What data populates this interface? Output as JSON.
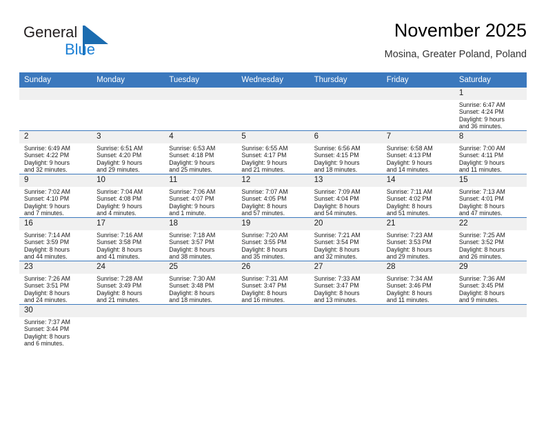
{
  "brand": {
    "name_part1": "General",
    "name_part2": "Blue",
    "logo_icon": "blue-triangle-mark",
    "color_primary": "#1b7fd4",
    "color_header": "#3b78bd"
  },
  "header": {
    "title": "November 2025",
    "subtitle": "Mosina, Greater Poland, Poland"
  },
  "calendar": {
    "weekday_headers": [
      "Sunday",
      "Monday",
      "Tuesday",
      "Wednesday",
      "Thursday",
      "Friday",
      "Saturday"
    ],
    "weeks": [
      [
        {
          "day": "",
          "empty": true
        },
        {
          "day": "",
          "empty": true
        },
        {
          "day": "",
          "empty": true
        },
        {
          "day": "",
          "empty": true
        },
        {
          "day": "",
          "empty": true
        },
        {
          "day": "",
          "empty": true
        },
        {
          "day": "1",
          "sunrise": "Sunrise: 6:47 AM",
          "sunset": "Sunset: 4:24 PM",
          "daylight1": "Daylight: 9 hours",
          "daylight2": "and 36 minutes."
        }
      ],
      [
        {
          "day": "2",
          "sunrise": "Sunrise: 6:49 AM",
          "sunset": "Sunset: 4:22 PM",
          "daylight1": "Daylight: 9 hours",
          "daylight2": "and 32 minutes."
        },
        {
          "day": "3",
          "sunrise": "Sunrise: 6:51 AM",
          "sunset": "Sunset: 4:20 PM",
          "daylight1": "Daylight: 9 hours",
          "daylight2": "and 29 minutes."
        },
        {
          "day": "4",
          "sunrise": "Sunrise: 6:53 AM",
          "sunset": "Sunset: 4:18 PM",
          "daylight1": "Daylight: 9 hours",
          "daylight2": "and 25 minutes."
        },
        {
          "day": "5",
          "sunrise": "Sunrise: 6:55 AM",
          "sunset": "Sunset: 4:17 PM",
          "daylight1": "Daylight: 9 hours",
          "daylight2": "and 21 minutes."
        },
        {
          "day": "6",
          "sunrise": "Sunrise: 6:56 AM",
          "sunset": "Sunset: 4:15 PM",
          "daylight1": "Daylight: 9 hours",
          "daylight2": "and 18 minutes."
        },
        {
          "day": "7",
          "sunrise": "Sunrise: 6:58 AM",
          "sunset": "Sunset: 4:13 PM",
          "daylight1": "Daylight: 9 hours",
          "daylight2": "and 14 minutes."
        },
        {
          "day": "8",
          "sunrise": "Sunrise: 7:00 AM",
          "sunset": "Sunset: 4:11 PM",
          "daylight1": "Daylight: 9 hours",
          "daylight2": "and 11 minutes."
        }
      ],
      [
        {
          "day": "9",
          "sunrise": "Sunrise: 7:02 AM",
          "sunset": "Sunset: 4:10 PM",
          "daylight1": "Daylight: 9 hours",
          "daylight2": "and 7 minutes."
        },
        {
          "day": "10",
          "sunrise": "Sunrise: 7:04 AM",
          "sunset": "Sunset: 4:08 PM",
          "daylight1": "Daylight: 9 hours",
          "daylight2": "and 4 minutes."
        },
        {
          "day": "11",
          "sunrise": "Sunrise: 7:06 AM",
          "sunset": "Sunset: 4:07 PM",
          "daylight1": "Daylight: 9 hours",
          "daylight2": "and 1 minute."
        },
        {
          "day": "12",
          "sunrise": "Sunrise: 7:07 AM",
          "sunset": "Sunset: 4:05 PM",
          "daylight1": "Daylight: 8 hours",
          "daylight2": "and 57 minutes."
        },
        {
          "day": "13",
          "sunrise": "Sunrise: 7:09 AM",
          "sunset": "Sunset: 4:04 PM",
          "daylight1": "Daylight: 8 hours",
          "daylight2": "and 54 minutes."
        },
        {
          "day": "14",
          "sunrise": "Sunrise: 7:11 AM",
          "sunset": "Sunset: 4:02 PM",
          "daylight1": "Daylight: 8 hours",
          "daylight2": "and 51 minutes."
        },
        {
          "day": "15",
          "sunrise": "Sunrise: 7:13 AM",
          "sunset": "Sunset: 4:01 PM",
          "daylight1": "Daylight: 8 hours",
          "daylight2": "and 47 minutes."
        }
      ],
      [
        {
          "day": "16",
          "sunrise": "Sunrise: 7:14 AM",
          "sunset": "Sunset: 3:59 PM",
          "daylight1": "Daylight: 8 hours",
          "daylight2": "and 44 minutes."
        },
        {
          "day": "17",
          "sunrise": "Sunrise: 7:16 AM",
          "sunset": "Sunset: 3:58 PM",
          "daylight1": "Daylight: 8 hours",
          "daylight2": "and 41 minutes."
        },
        {
          "day": "18",
          "sunrise": "Sunrise: 7:18 AM",
          "sunset": "Sunset: 3:57 PM",
          "daylight1": "Daylight: 8 hours",
          "daylight2": "and 38 minutes."
        },
        {
          "day": "19",
          "sunrise": "Sunrise: 7:20 AM",
          "sunset": "Sunset: 3:55 PM",
          "daylight1": "Daylight: 8 hours",
          "daylight2": "and 35 minutes."
        },
        {
          "day": "20",
          "sunrise": "Sunrise: 7:21 AM",
          "sunset": "Sunset: 3:54 PM",
          "daylight1": "Daylight: 8 hours",
          "daylight2": "and 32 minutes."
        },
        {
          "day": "21",
          "sunrise": "Sunrise: 7:23 AM",
          "sunset": "Sunset: 3:53 PM",
          "daylight1": "Daylight: 8 hours",
          "daylight2": "and 29 minutes."
        },
        {
          "day": "22",
          "sunrise": "Sunrise: 7:25 AM",
          "sunset": "Sunset: 3:52 PM",
          "daylight1": "Daylight: 8 hours",
          "daylight2": "and 26 minutes."
        }
      ],
      [
        {
          "day": "23",
          "sunrise": "Sunrise: 7:26 AM",
          "sunset": "Sunset: 3:51 PM",
          "daylight1": "Daylight: 8 hours",
          "daylight2": "and 24 minutes."
        },
        {
          "day": "24",
          "sunrise": "Sunrise: 7:28 AM",
          "sunset": "Sunset: 3:49 PM",
          "daylight1": "Daylight: 8 hours",
          "daylight2": "and 21 minutes."
        },
        {
          "day": "25",
          "sunrise": "Sunrise: 7:30 AM",
          "sunset": "Sunset: 3:48 PM",
          "daylight1": "Daylight: 8 hours",
          "daylight2": "and 18 minutes."
        },
        {
          "day": "26",
          "sunrise": "Sunrise: 7:31 AM",
          "sunset": "Sunset: 3:47 PM",
          "daylight1": "Daylight: 8 hours",
          "daylight2": "and 16 minutes."
        },
        {
          "day": "27",
          "sunrise": "Sunrise: 7:33 AM",
          "sunset": "Sunset: 3:47 PM",
          "daylight1": "Daylight: 8 hours",
          "daylight2": "and 13 minutes."
        },
        {
          "day": "28",
          "sunrise": "Sunrise: 7:34 AM",
          "sunset": "Sunset: 3:46 PM",
          "daylight1": "Daylight: 8 hours",
          "daylight2": "and 11 minutes."
        },
        {
          "day": "29",
          "sunrise": "Sunrise: 7:36 AM",
          "sunset": "Sunset: 3:45 PM",
          "daylight1": "Daylight: 8 hours",
          "daylight2": "and 9 minutes."
        }
      ],
      [
        {
          "day": "30",
          "sunrise": "Sunrise: 7:37 AM",
          "sunset": "Sunset: 3:44 PM",
          "daylight1": "Daylight: 8 hours",
          "daylight2": "and 6 minutes."
        },
        {
          "day": "",
          "empty": true
        },
        {
          "day": "",
          "empty": true
        },
        {
          "day": "",
          "empty": true
        },
        {
          "day": "",
          "empty": true
        },
        {
          "day": "",
          "empty": true
        },
        {
          "day": "",
          "empty": true
        }
      ]
    ]
  }
}
